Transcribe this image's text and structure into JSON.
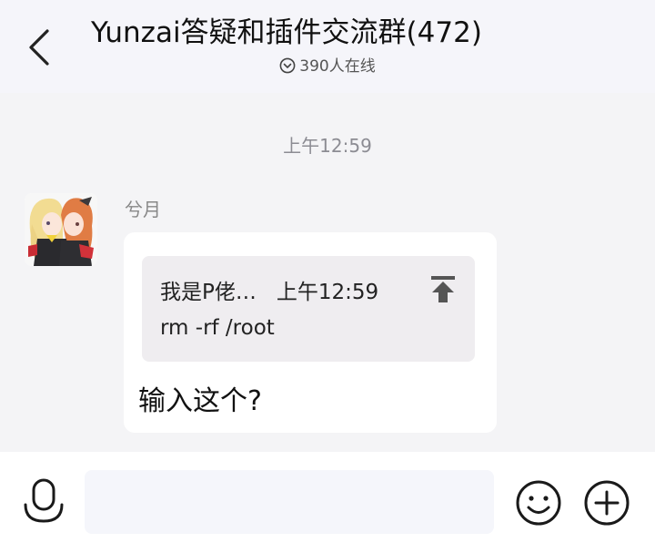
{
  "header": {
    "title": "Yunzai答疑和插件交流群(472)",
    "online_status": "390人在线",
    "back_icon": "chevron-left-icon"
  },
  "chat": {
    "timestamp": "上午12:59",
    "message": {
      "sender": "兮月",
      "quote": {
        "author": "我是P佬…",
        "time": "上午12:59",
        "text": "rm -rf /root",
        "icon": "pin-to-top-icon"
      },
      "text": "输入这个?"
    }
  },
  "input_bar": {
    "value": "",
    "placeholder": "",
    "voice_icon": "microphone-icon",
    "emoji_icon": "smiley-icon",
    "plus_icon": "plus-circle-icon"
  },
  "colors": {
    "header_bg": "#f5f5fa",
    "chat_bg": "#f4f4f6",
    "bubble_bg": "#ffffff",
    "quote_bg": "#efedf0",
    "muted_text": "#8c8c93"
  }
}
